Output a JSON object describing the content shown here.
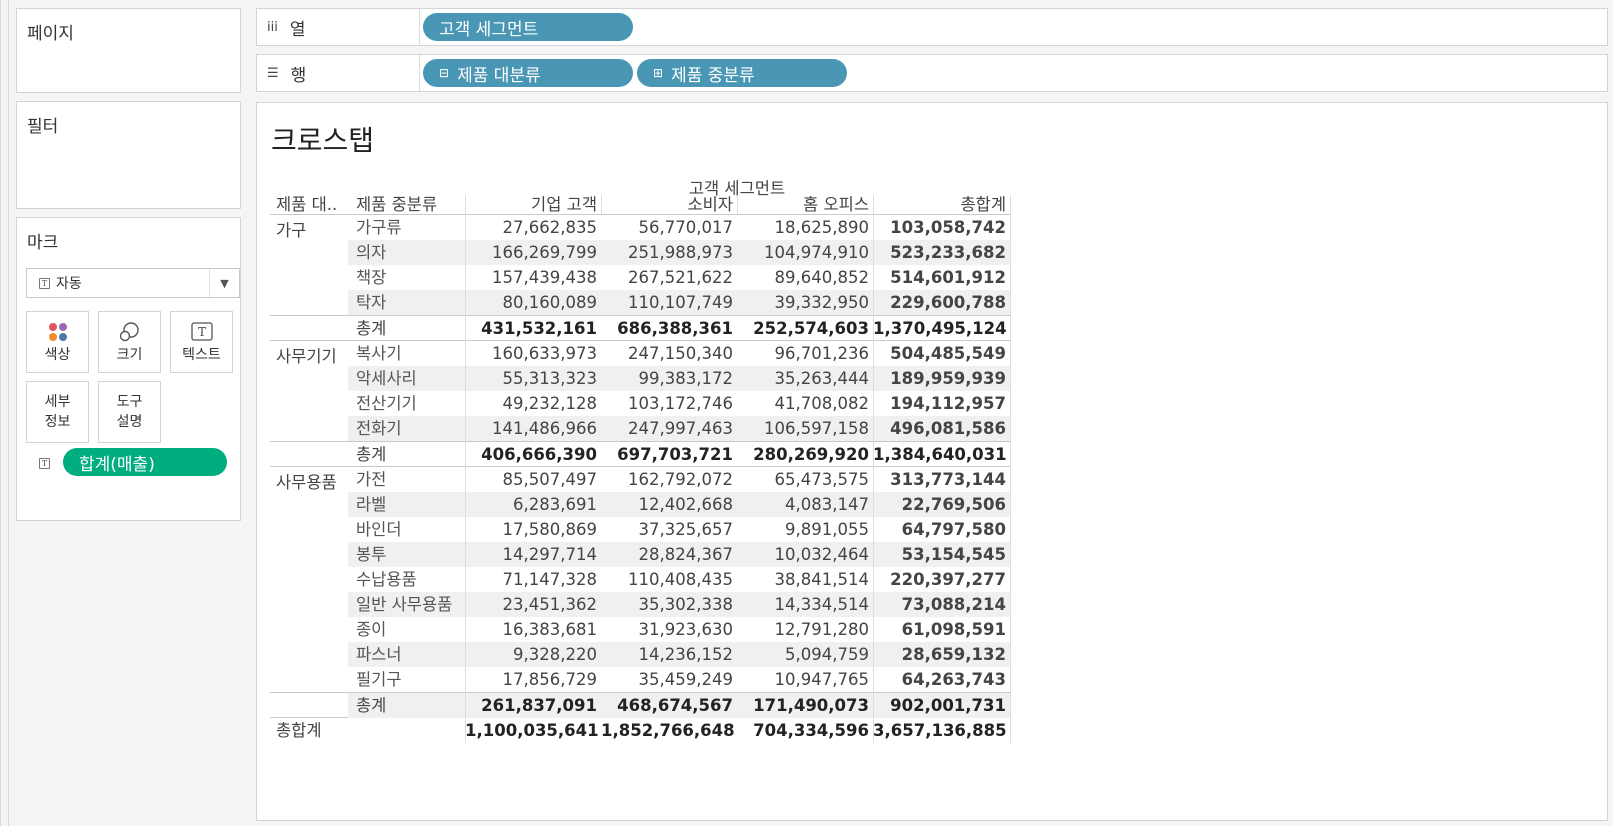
{
  "cards": {
    "pages": {
      "title": "페이지"
    },
    "filters": {
      "title": "필터"
    },
    "marks": {
      "title": "마크",
      "mark_type": "자동",
      "buttons": {
        "color": "색상",
        "size": "크기",
        "text": "텍스트",
        "detail": "세부\n정보",
        "tooltip": "도구\n설명"
      },
      "detail_line1": "세부",
      "detail_line2": "정보",
      "tooltip_line1": "도구",
      "tooltip_line2": "설명",
      "measure_pill": "합계(매출)"
    }
  },
  "shelves": {
    "columns": {
      "label": "열",
      "pills": [
        "고객 세그먼트"
      ]
    },
    "rows": {
      "label": "행",
      "pills": [
        "제품 대분류",
        "제품 중분류"
      ]
    }
  },
  "view": {
    "title": "크로스탭",
    "crosstab": {
      "column_group_header": "고객 세그먼트",
      "headers": {
        "category": "제품 대..",
        "subcategory": "제품 중분류",
        "segments": [
          "기업 고객",
          "소비자",
          "홈 오피스"
        ],
        "grand_total": "총합계"
      },
      "groups": [
        {
          "name": "가구",
          "rows": [
            {
              "sub": "가구류",
              "v": [
                "27,662,835",
                "56,770,017",
                "18,625,890",
                "103,058,742"
              ]
            },
            {
              "sub": "의자",
              "v": [
                "166,269,799",
                "251,988,973",
                "104,974,910",
                "523,233,682"
              ]
            },
            {
              "sub": "책장",
              "v": [
                "157,439,438",
                "267,521,622",
                "89,640,852",
                "514,601,912"
              ]
            },
            {
              "sub": "탁자",
              "v": [
                "80,160,089",
                "110,107,749",
                "39,332,950",
                "229,600,788"
              ]
            }
          ],
          "total": {
            "sub": "총계",
            "v": [
              "431,532,161",
              "686,388,361",
              "252,574,603",
              "1,370,495,124"
            ]
          }
        },
        {
          "name": "사무기기",
          "rows": [
            {
              "sub": "복사기",
              "v": [
                "160,633,973",
                "247,150,340",
                "96,701,236",
                "504,485,549"
              ]
            },
            {
              "sub": "악세사리",
              "v": [
                "55,313,323",
                "99,383,172",
                "35,263,444",
                "189,959,939"
              ]
            },
            {
              "sub": "전산기기",
              "v": [
                "49,232,128",
                "103,172,746",
                "41,708,082",
                "194,112,957"
              ]
            },
            {
              "sub": "전화기",
              "v": [
                "141,486,966",
                "247,997,463",
                "106,597,158",
                "496,081,586"
              ]
            }
          ],
          "total": {
            "sub": "총계",
            "v": [
              "406,666,390",
              "697,703,721",
              "280,269,920",
              "1,384,640,031"
            ]
          }
        },
        {
          "name": "사무용품",
          "rows": [
            {
              "sub": "가전",
              "v": [
                "85,507,497",
                "162,792,072",
                "65,473,575",
                "313,773,144"
              ]
            },
            {
              "sub": "라벨",
              "v": [
                "6,283,691",
                "12,402,668",
                "4,083,147",
                "22,769,506"
              ]
            },
            {
              "sub": "바인더",
              "v": [
                "17,580,869",
                "37,325,657",
                "9,891,055",
                "64,797,580"
              ]
            },
            {
              "sub": "봉투",
              "v": [
                "14,297,714",
                "28,824,367",
                "10,032,464",
                "53,154,545"
              ]
            },
            {
              "sub": "수납용품",
              "v": [
                "71,147,328",
                "110,408,435",
                "38,841,514",
                "220,397,277"
              ]
            },
            {
              "sub": "일반 사무용품",
              "v": [
                "23,451,362",
                "35,302,338",
                "14,334,514",
                "73,088,214"
              ]
            },
            {
              "sub": "종이",
              "v": [
                "16,383,681",
                "31,923,630",
                "12,791,280",
                "61,098,591"
              ]
            },
            {
              "sub": "파스너",
              "v": [
                "9,328,220",
                "14,236,152",
                "5,094,759",
                "28,659,132"
              ]
            },
            {
              "sub": "필기구",
              "v": [
                "17,856,729",
                "35,459,249",
                "10,947,765",
                "64,263,743"
              ]
            }
          ],
          "total": {
            "sub": "총계",
            "v": [
              "261,837,091",
              "468,674,567",
              "171,490,073",
              "902,001,731"
            ]
          }
        }
      ],
      "grand_total_row": {
        "label": "총합계",
        "v": [
          "1,100,035,641",
          "1,852,766,648",
          "704,334,596",
          "3,657,136,885"
        ]
      }
    }
  },
  "colors": {
    "pill_dimension": "#4a96b5",
    "pill_measure": "#00ad7e",
    "shade_row": "#f0f0f0"
  },
  "icons": {
    "columns_shelf": "columns-icon",
    "rows_shelf": "rows-icon",
    "text_mark": "text-t-icon",
    "color_mark": "color-dots-icon",
    "size_mark": "size-circles-icon"
  }
}
